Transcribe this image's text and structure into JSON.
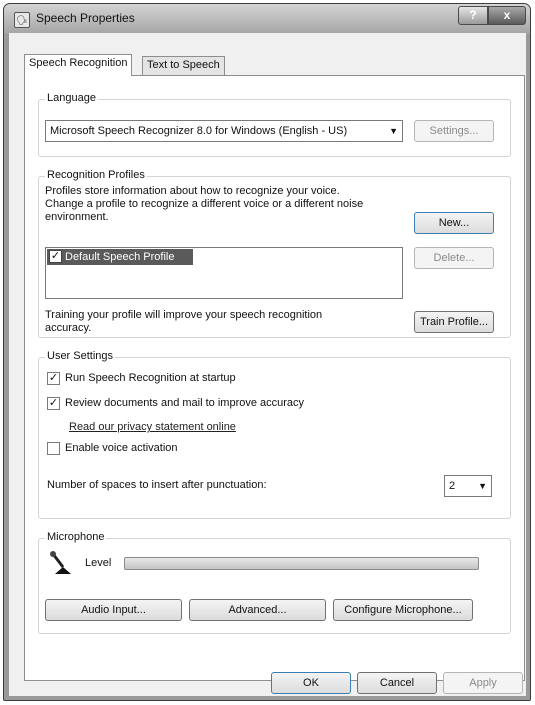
{
  "window": {
    "title": "Speech Properties",
    "help_label": "?",
    "close_label": "x"
  },
  "tabs": [
    {
      "label": "Speech Recognition",
      "active": true
    },
    {
      "label": "Text to Speech",
      "active": false
    }
  ],
  "language": {
    "legend": "Language",
    "selected": "Microsoft Speech Recognizer 8.0 for Windows (English - US)",
    "settings_button": "Settings..."
  },
  "profiles": {
    "legend": "Recognition Profiles",
    "description_line1": "Profiles store information about how to recognize your voice.",
    "description_line2": "Change a profile to recognize a different voice or a different noise",
    "description_line3": "environment.",
    "new_button": "New...",
    "delete_button": "Delete...",
    "items": [
      {
        "label": "Default Speech Profile",
        "checked": true
      }
    ],
    "training_line1": "Training your profile will improve your speech recognition",
    "training_line2": "accuracy.",
    "train_button": "Train Profile..."
  },
  "user_settings": {
    "legend": "User Settings",
    "run_at_startup": {
      "label": "Run Speech Recognition at startup",
      "checked": true
    },
    "review_documents": {
      "label": "Review documents and mail to improve accuracy",
      "checked": true
    },
    "privacy_link": "Read our privacy statement online",
    "voice_activation": {
      "label": "Enable voice activation",
      "checked": false
    },
    "spaces_label": "Number of spaces to insert after punctuation:",
    "spaces_value": "2"
  },
  "microphone": {
    "legend": "Microphone",
    "icon": "microphone-icon",
    "level_label": "Level",
    "level": 0,
    "audio_input_button": "Audio Input...",
    "advanced_button": "Advanced...",
    "configure_button": "Configure Microphone..."
  },
  "footer": {
    "ok_button": "OK",
    "cancel_button": "Cancel",
    "apply_button": "Apply"
  },
  "glyphs": {
    "check": "✓",
    "dropdown": "▼",
    "app_icon": "🗣"
  }
}
